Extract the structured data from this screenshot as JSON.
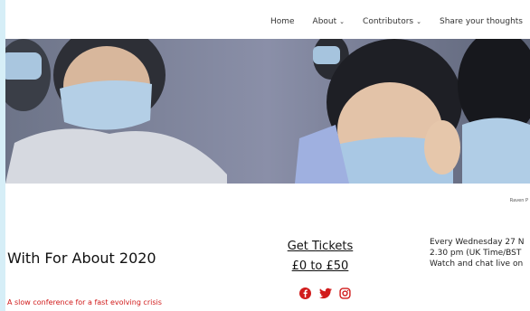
{
  "nav": {
    "items": [
      {
        "label": "Home",
        "has_menu": false
      },
      {
        "label": "About",
        "has_menu": true
      },
      {
        "label": "Contributors",
        "has_menu": true
      },
      {
        "label": "Share your thoughts",
        "has_menu": false
      }
    ]
  },
  "hero": {
    "caption": "Raven P"
  },
  "main": {
    "title": "With For About 2020",
    "tagline": "A slow conference for a fast evolving crisis"
  },
  "tickets": {
    "link_label": "Get Tickets",
    "price_label": "£0 to £50"
  },
  "social": [
    {
      "icon": "facebook-icon"
    },
    {
      "icon": "twitter-icon"
    },
    {
      "icon": "instagram-icon"
    }
  ],
  "schedule": {
    "line1": "Every Wednesday 27 N",
    "line2": "2.30 pm  (UK Time/BST",
    "line3": "Watch and chat live on"
  },
  "colors": {
    "accent_red": "#d11b1b",
    "page_bg": "#d6eef7"
  }
}
